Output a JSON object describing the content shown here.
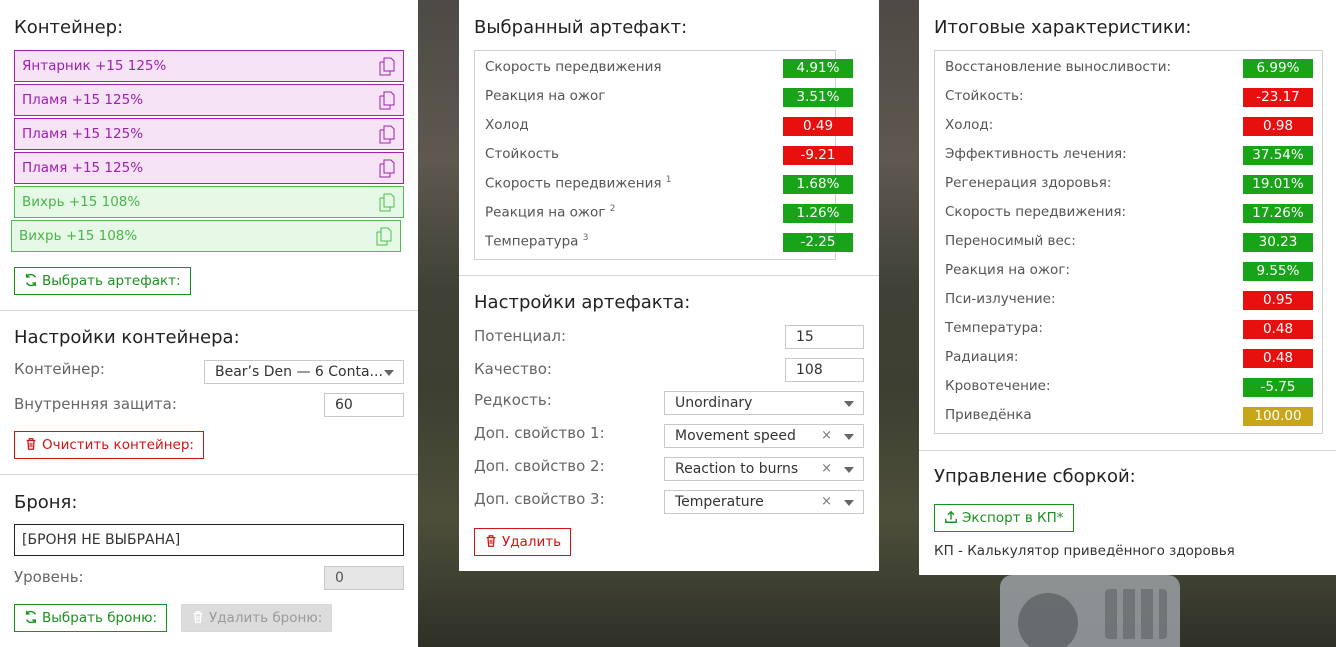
{
  "container_panel": {
    "title": "Контейнер:",
    "items": [
      {
        "label": "Янтарник +15 125%",
        "color": "purple"
      },
      {
        "label": "Пламя +15 125%",
        "color": "purple"
      },
      {
        "label": "Пламя +15 125%",
        "color": "purple"
      },
      {
        "label": "Пламя +15 125%",
        "color": "purple"
      },
      {
        "label": "Вихрь +15 108%",
        "color": "green"
      },
      {
        "label": "Вихрь +15 108%",
        "color": "green"
      }
    ],
    "choose_artifact_label": "Выбрать артефакт:"
  },
  "container_settings": {
    "title": "Настройки контейнера:",
    "container_label": "Контейнер:",
    "container_value": "Bear’s Den — 6 Conta...",
    "inner_protection_label": "Внутренняя защита:",
    "inner_protection_value": "60",
    "clear_label": "Очистить контейнер:"
  },
  "armor": {
    "title": "Броня:",
    "field_value": "[БРОНЯ НЕ ВЫБРАНА]",
    "level_label": "Уровень:",
    "level_value": "0",
    "choose_label": "Выбрать броню:",
    "remove_label": "Удалить броню:"
  },
  "selected_artifact": {
    "title": "Выбранный артефакт:",
    "stats": [
      {
        "name": "Скорость передвижения",
        "sup": "",
        "value": "4.91%",
        "color": "green"
      },
      {
        "name": "Реакция на ожог",
        "sup": "",
        "value": "3.51%",
        "color": "green"
      },
      {
        "name": "Холод",
        "sup": "",
        "value": "0.49",
        "color": "red"
      },
      {
        "name": "Стойкость",
        "sup": "",
        "value": "-9.21",
        "color": "red"
      },
      {
        "name": "Скорость передвижения",
        "sup": "1",
        "value": "1.68%",
        "color": "green"
      },
      {
        "name": "Реакция на ожог",
        "sup": "2",
        "value": "1.26%",
        "color": "green"
      },
      {
        "name": "Температура",
        "sup": "3",
        "value": "-2.25",
        "color": "green"
      }
    ]
  },
  "artifact_settings": {
    "title": "Настройки артефакта:",
    "potential_label": "Потенциал:",
    "potential_value": "15",
    "quality_label": "Качество:",
    "quality_value": "108",
    "rarity_label": "Редкость:",
    "rarity_value": "Unordinary",
    "extra1_label": "Доп. свойство 1:",
    "extra1_value": "Movement speed",
    "extra2_label": "Доп. свойство 2:",
    "extra2_value": "Reaction to burns",
    "extra3_label": "Доп. свойство 3:",
    "extra3_value": "Temperature",
    "clear_symbol": "×",
    "delete_label": "Удалить"
  },
  "totals": {
    "title": "Итоговые характеристики:",
    "stats": [
      {
        "name": "Восстановление выносливости:",
        "value": "6.99%",
        "color": "green"
      },
      {
        "name": "Стойкость:",
        "value": "-23.17",
        "color": "red"
      },
      {
        "name": "Холод:",
        "value": "0.98",
        "color": "red"
      },
      {
        "name": "Эффективность лечения:",
        "value": "37.54%",
        "color": "green"
      },
      {
        "name": "Регенерация здоровья:",
        "value": "19.01%",
        "color": "green"
      },
      {
        "name": "Скорость передвижения:",
        "value": "17.26%",
        "color": "green"
      },
      {
        "name": "Переносимый вес:",
        "value": "30.23",
        "color": "green"
      },
      {
        "name": "Реакция на ожог:",
        "value": "9.55%",
        "color": "green"
      },
      {
        "name": "Пси-излучение:",
        "value": "0.95",
        "color": "red"
      },
      {
        "name": "Температура:",
        "value": "0.48",
        "color": "red"
      },
      {
        "name": "Радиация:",
        "value": "0.48",
        "color": "red"
      },
      {
        "name": "Кровотечение:",
        "value": "-5.75",
        "color": "green"
      },
      {
        "name": "Приведёнка",
        "value": "100.00",
        "color": "gold"
      }
    ]
  },
  "build": {
    "title": "Управление сборкой:",
    "export_label": "Экспорт в КП*",
    "note": "КП - Калькулятор приведённого здоровья"
  },
  "colors": {
    "green": "#18a319",
    "red": "#e80f0f",
    "gold": "#c7a61b",
    "purple_border": "#a020b0",
    "green_border": "#4cc04c"
  }
}
